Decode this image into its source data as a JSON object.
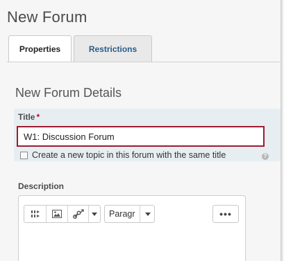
{
  "page": {
    "title": "New Forum"
  },
  "tabs": [
    {
      "label": "Properties",
      "active": true
    },
    {
      "label": "Restrictions",
      "active": false
    }
  ],
  "section": {
    "title": "New Forum Details"
  },
  "title_field": {
    "label": "Title",
    "required_marker": "*",
    "value": "W1: Discussion Forum"
  },
  "same_title_checkbox": {
    "label": "Create a new topic in this forum with the same title",
    "checked": false,
    "help_icon": "question-circle-icon"
  },
  "description": {
    "label": "Description",
    "toolbar": {
      "icons": [
        "insert-stuff-icon",
        "insert-image-icon",
        "insert-quicklink-icon",
        "dropdown-arrow-icon"
      ],
      "format_select": "Paragr",
      "more_icon": "more-actions-icon"
    }
  },
  "colors": {
    "accent_tab_text": "#2a5d88",
    "required": "#d0021b",
    "input_focus_border": "#9b1c2e",
    "field_band": "#e7eef2"
  }
}
